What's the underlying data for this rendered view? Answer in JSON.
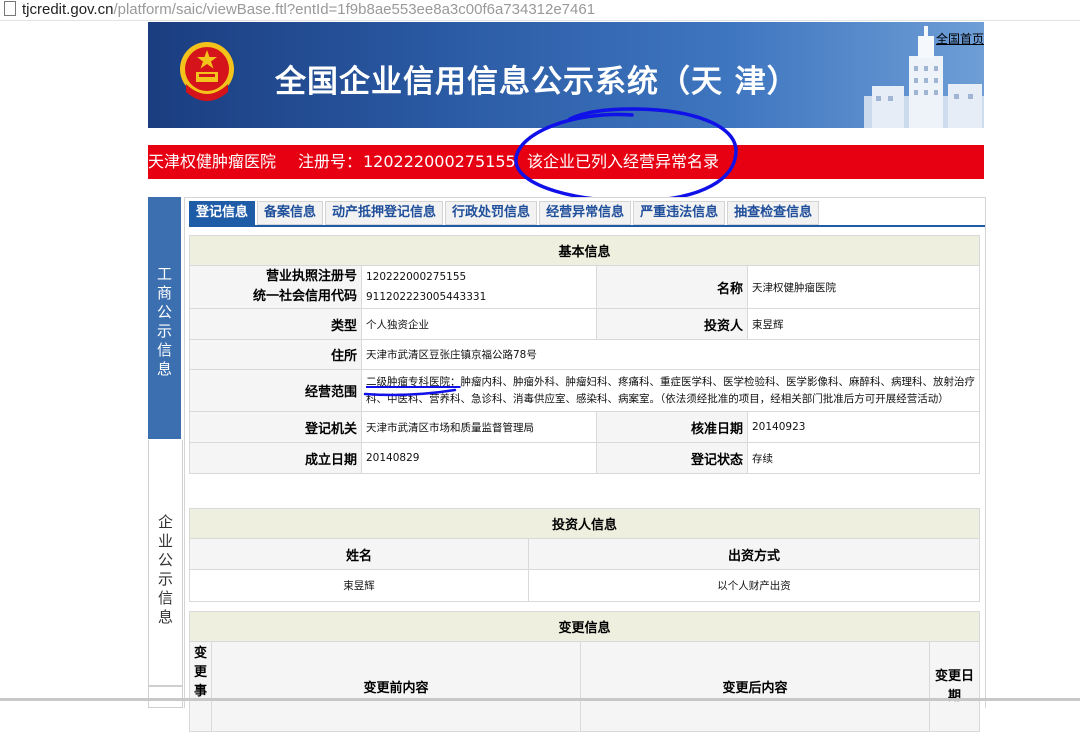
{
  "address_bar": {
    "host": "tjcredit.gov.cn",
    "path": "/platform/saic/viewBase.ftl?entId=1f9b8ae553ee8a3c00f6a734312e7461"
  },
  "banner": {
    "title": "全国企业信用信息公示系统（天 津）",
    "home_link": "全国首页"
  },
  "company_bar": {
    "name": "天津权健肿瘤医院",
    "reg_label": "注册号：",
    "reg_no": "120222000275155",
    "alert": "该企业已列入经营异常名录"
  },
  "side_tabs": [
    {
      "label": "工商公示信息"
    },
    {
      "label": "企业公示信息"
    }
  ],
  "tabs": [
    {
      "label": "登记信息",
      "active": true
    },
    {
      "label": "备案信息"
    },
    {
      "label": "动产抵押登记信息"
    },
    {
      "label": "行政处罚信息"
    },
    {
      "label": "经营异常信息"
    },
    {
      "label": "严重违法信息"
    },
    {
      "label": "抽查检查信息"
    }
  ],
  "basic": {
    "header": "基本信息",
    "license_no_label": "营业执照注册号",
    "license_no": "120222000275155",
    "credit_code_label": "统一社会信用代码",
    "credit_code": "911202223005443331",
    "name_label": "名称",
    "name": "天津权健肿瘤医院",
    "type_label": "类型",
    "type": "个人独资企业",
    "investor_label": "投资人",
    "investor": "束昱辉",
    "address_label": "住所",
    "address": "天津市武清区豆张庄镇京福公路78号",
    "scope_label": "经营范围",
    "scope_highlight": "二级肿瘤专科医院：",
    "scope_rest": "肿瘤内科、肿瘤外科、肿瘤妇科、疼痛科、重症医学科、医学检验科、医学影像科、麻醉科、病理科、放射治疗科、中医科、营养科、急诊科、消毒供应室、感染科、病案室。（依法须经批准的项目，经相关部门批准后方可开展经营活动）",
    "authority_label": "登记机关",
    "authority": "天津市武清区市场和质量监督管理局",
    "approval_date_label": "核准日期",
    "approval_date": "20140923",
    "found_date_label": "成立日期",
    "found_date": "20140829",
    "status_label": "登记状态",
    "status": "存续"
  },
  "investors": {
    "header": "投资人信息",
    "col_name": "姓名",
    "col_method": "出资方式",
    "rows": [
      {
        "name": "束昱辉",
        "method": "以个人财产出资"
      }
    ]
  },
  "changes": {
    "header": "变更信息",
    "col_item": "变更事",
    "col_before": "变更前内容",
    "col_after": "变更后内容",
    "col_date": "变更日期"
  },
  "colors": {
    "banner_blue": "#1b3d80",
    "red_bar": "#e60012",
    "tab_blue": "#1f5ca8",
    "annotation_blue": "#1010e8"
  }
}
